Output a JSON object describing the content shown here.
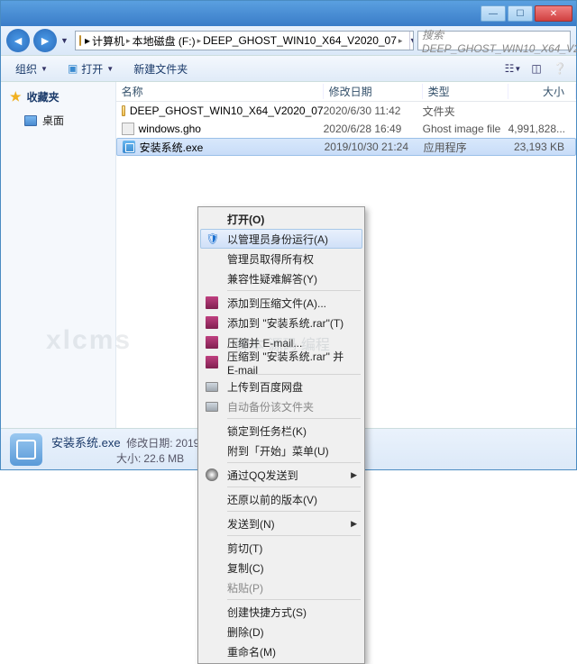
{
  "window": {
    "min": "—",
    "max": "☐",
    "close": "✕"
  },
  "nav": {
    "back": "◄",
    "fwd": "►",
    "crumb1": "计算机",
    "crumb2": "本地磁盘 (F:)",
    "crumb3": "DEEP_GHOST_WIN10_X64_V2020_07",
    "refresh": "↻",
    "search_placeholder": "搜索 DEEP_GHOST_WIN10_X64_V2..."
  },
  "toolbar": {
    "organize": "组织",
    "open": "打开",
    "newfolder": "新建文件夹"
  },
  "sidebar": {
    "fav": "收藏夹",
    "desktop": "桌面"
  },
  "columns": {
    "name": "名称",
    "date": "修改日期",
    "type": "类型",
    "size": "大小"
  },
  "rows": [
    {
      "name": "DEEP_GHOST_WIN10_X64_V2020_07",
      "date": "2020/6/30 11:42",
      "type": "文件夹",
      "size": ""
    },
    {
      "name": "windows.gho",
      "date": "2020/6/28 16:49",
      "type": "Ghost image file",
      "size": "4,991,828..."
    },
    {
      "name": "安装系统.exe",
      "date": "2019/10/30 21:24",
      "type": "应用程序",
      "size": "23,193 KB"
    }
  ],
  "context": {
    "open": "打开(O)",
    "runas": "以管理员身份运行(A)",
    "owner": "管理员取得所有权",
    "compat": "兼容性疑难解答(Y)",
    "addarchive": "添加到压缩文件(A)...",
    "addrar": "添加到 \"安装系统.rar\"(T)",
    "zipemail": "压缩并 E-mail...",
    "ziprar_email": "压缩到 \"安装系统.rar\" 并 E-mail",
    "upload": "上传到百度网盘",
    "autobak": "自动备份该文件夹",
    "pin_taskbar": "锁定到任务栏(K)",
    "pin_start": "附到「开始」菜单(U)",
    "qqsend": "通过QQ发送到",
    "restore": "还原以前的版本(V)",
    "sendto": "发送到(N)",
    "cut": "剪切(T)",
    "copy": "复制(C)",
    "paste": "粘贴(P)",
    "shortcut": "创建快捷方式(S)",
    "delete": "删除(D)",
    "rename": "重命名(M)"
  },
  "status": {
    "filename": "安装系统.exe",
    "mod_label": "修改日期:",
    "mod_value": "2019/10/30 21:2",
    "size_label": "大小:",
    "size_value": "22.6 MB"
  },
  "watermark": "xlcms",
  "watermark2": "脚本 源码 编程"
}
